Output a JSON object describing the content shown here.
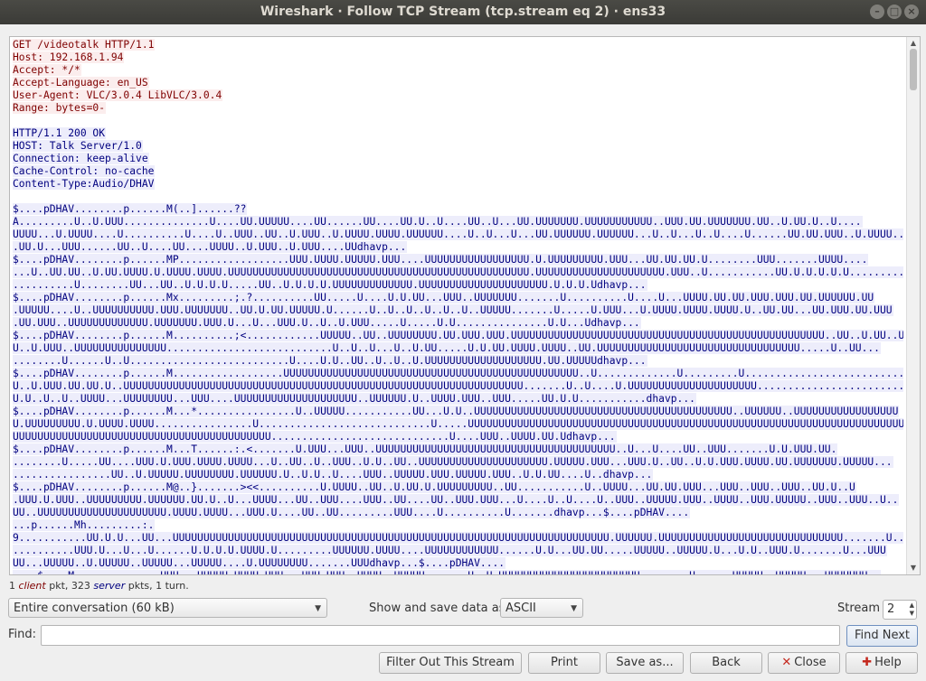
{
  "window": {
    "title": "Wireshark · Follow TCP Stream (tcp.stream eq 2) · ens33",
    "buttons": [
      "minimize-icon",
      "maximize-icon",
      "close-icon"
    ]
  },
  "stream": {
    "client_lines": [
      "GET /videotalk HTTP/1.1",
      "Host: 192.168.1.94",
      "Accept: */*",
      "Accept-Language: en_US",
      "User-Agent: VLC/3.0.4 LibVLC/3.0.4",
      "Range: bytes=0-"
    ],
    "server_lines": [
      "HTTP/1.1 200 OK",
      "HOST: Talk Server/1.0",
      "Connection: keep-alive",
      "Cache-Control: no-cache",
      "Content-Type:Audio/DHAV",
      "",
      "$....pDHAV........p......M(..]......??",
      "A.........U..U.UUU..............U....UU.UUUUU....UU......UU....UU.U..U....UU..U...UU.UUUUUUU.UUUUUUUUUUU..UUU.UU.UUUUUUU.UU..U.UU.U..U....",
      "UUUU...U.UUUU....U..........U....U..UUU..UU..U.UUU..U.UUUU.UUUU.UUUUUU....U..U...U...UU.UUUUUU.UUUUUU...U..U...U..U....U......UU.UU.UUU..U.UUUU..",
      ".UU.U...UUU......UU..U....UU....UUUU..U.UUU..U.UUU....UUdhavp...",
      "$....pDHAV........p......MP..................UUU.UUUU.UUUUU.UUU....UUUUUUUUUUUUUUUUU.U.UUUUUUUUU.UUU...UU.UU.UU.U........UUU.......UUUU....",
      "...U..UU.UU..U.UU.UUUU.U.UUUU.UUUU.UUUUUUUUUUUUUUUUUUUUUUUUUUUUUUUUUUUUUUUUUUUUUUUUU.UUUUUUUUUUUUUUUUUUUUU.UUU..U...........UU.U.U.U.U.U.........",
      "..........U........UU...UU..U.U.U.U.....UU..U.U.U.U.UUUUUUUUUUUUU.UUUUUUUUUUUUUUUUUUUUU.U.U.U.Udhavp...",
      "$....pDHAV........p......Mx.........;.?..........UU.....U....U.U.UU...UUU..UUUUUUU.......U..........U....U...UUUU.UU.UU.UUU.UUU.UU.UUUUUU.UU",
      ".UUUUU....U..UUUUUUUUUU.UUU.UUUUUUU..UU.U.UU.UUUUU.U......U..U..U..U..U..U..UUUUU.......U.....U.UUU...U.UUUU.UUUU.UUUU.U..UU.UU...UU.UUU.UU.UUU",
      ".UU.UUU..UUUUUUUUUUUUU.UUUUUUU.UUU.U...U...UUU.U..U..U.UUU.....U.....U.U...............U.U...Udhavp...",
      "$....pDHAV........p......M..........;<............UUUUU..UU..UUUUUUUU.UU.UUU.UUU.UUUUUUUUUUUUUUUUUUUUUUUUUUUUUUUUUUUUUUUUUUUUUUUUUUU..UU..U.UU..U",
      "U..U.UUU..UUUUUUUUUUUUUUU...........................U..U..U...U..U.UU.....U.U.UU.UUUU.UUUU..UU.UUUUUUUUUUUUUUUUUUUUUUUUUUUUUUUUU.....U..UU...",
      "........U......U..U..........................U....U.U..UU..U..U..U.UUUUUUUUUUUUUUUUUUU.UU.UUUUUdhavp...",
      "$....pDHAV........p......M..................UUUUUUUUUUUUUUUUUUUUUUUUUUUUUUUUUUUUUUUUUUUUUUUU..U.............U.........U..........................U....",
      "U..U.UUU.UU.UU.U..UUUUUUUUUUUUUUUUUUUUUUUUUUUUUUUUUUUUUUUUUUUUUUUUUUUUUUUUUUUUUUUUU.......U..U....U.UUUUUUUUUUUUUUUUUUUUU..........................UUUU.U.U",
      "U.U..U..U..UUUU...UUUUUUUU...UUU....UUUUUUUUUUUUUUUUUUUU..UUUUUU.U..UUUU.UUU..UUU.....UU.U.U...........dhavp...",
      "$....pDHAV........p......M...*................U..UUUUU...........UU...U.U..UUUUUUUUUUUUUUUUUUUUUUUUUUUUUUUUUUUUUUUUUU..UUUUUU..UUUUUUUUUUUUUUUUU",
      "U.UUUUUUUUU.U.UUUU.UUUU................U............................U.....UUUUUUUUUUUUUUUUUUUUUUUUUUUUUUUUUUUUUUUUUUUUUUUUUUUUUUUUUUUUUUUUUUUUUUUU",
      "UUUUUUUUUUUUUUUUUUUUUUUUUUUUUUUUUUUUUUUUUU.............................U....UUU..UUUU.UU.Udhavp...",
      "$....pDHAV........p......M...T......:.<.......U.UUU...UUU..UUUUUUUUUUUUUUUUUUUUUUUUUUUUUUUUUUUUUUU..U...U....UU..UUU.......U.U.UUU.UU.",
      "........U.....UU....UUU.U.UUU.UUUU.UUUU...U..UU..U..UUU..U.U..UU..UUUUUUUUUUUUUUUUUUUUU.UUUUU.UUU...UUU.U..UU..U.U.UUU.UUUU.UU.UUUUUUU.UUUUU...",
      "................UU..U.UUUUU.UUUUUUUU.UUUUUU.U..U.U..U....UUU..UUUUU.UUU.UUUUU.UUU..U.U.UU....U..dhavp...",
      "$....pDHAV........p......M@..}.......><<..........U.UUUU..UU..U.UU.U.UUUUUUUUU..UU...........U..UUUU...UU.UU.UUU...UUU..UUU..UUU..UU.U..U",
      ".UUU.U.UUU..UUUUUUUUU.UUUUUU.UU.U..U...UUUU...UU..UUU....UUU..UU....UU..UUU.UUU...U....U..U....U..UUU..UUUUU.UUU..UUUU..UUU.UUUUU..UUU..UUU..U..",
      "UU..UUUUUUUUUUUUUUUUUUUUU.UUUU.UUUU...UUU.U....UU..UU.........UUU....U..........U.......dhavp...$....pDHAV....",
      "...p......Mh.........:.",
      "9...........UU.U.U...UU...UUUUUUUUUUUUUUUUUUUUUUUUUUUUUUUUUUUUUUUUUUUUUUUUUUUUUUUUUUUUUUUUUUUUUUU.UUUUUU.UUUUUUUUUUUUUUUUUUUUUUUUUUUUUU.......U........",
      "..........UUU.U...U...U......U.U.U.U.UUUU.U.........UUUUUU.UUUU....UUUUUUUUUUUU......U.U...UU.UU.....UUUUU..UUUUU.U...U.U..UUU.U.......U...UUU",
      "UU...UUUUU..U.UUUUU..UUUUU...UUUUU....U.UUUUUUUU.......UUUdhavp...$....pDHAV....",
      "....$....M..............UUU...UUUUU.UUUU.UUU...UUU.UUU..UUUU..UUUUU.......U..U.UUUUUUUUUUUUUUUUUUUUUUU........U......UUUUU..UUUUU...UUUUUUU.."
    ]
  },
  "stats": {
    "client_count": "1",
    "client_word": "client",
    "mid": "pkt,",
    "server_count": "323",
    "server_word": "server",
    "tail": "pkts, 1 turn."
  },
  "controls": {
    "conversation_select": "Entire conversation (60 kB)",
    "show_save_label": "Show and save data as",
    "format_select": "ASCII",
    "stream_label": "Stream",
    "stream_value": "2",
    "find_label": "Find:",
    "find_value": "",
    "find_next": "Find Next"
  },
  "buttons": {
    "filter_out": "Filter Out This Stream",
    "print": "Print",
    "save_as": "Save as...",
    "back": "Back",
    "close": "Close",
    "help": "Help"
  }
}
